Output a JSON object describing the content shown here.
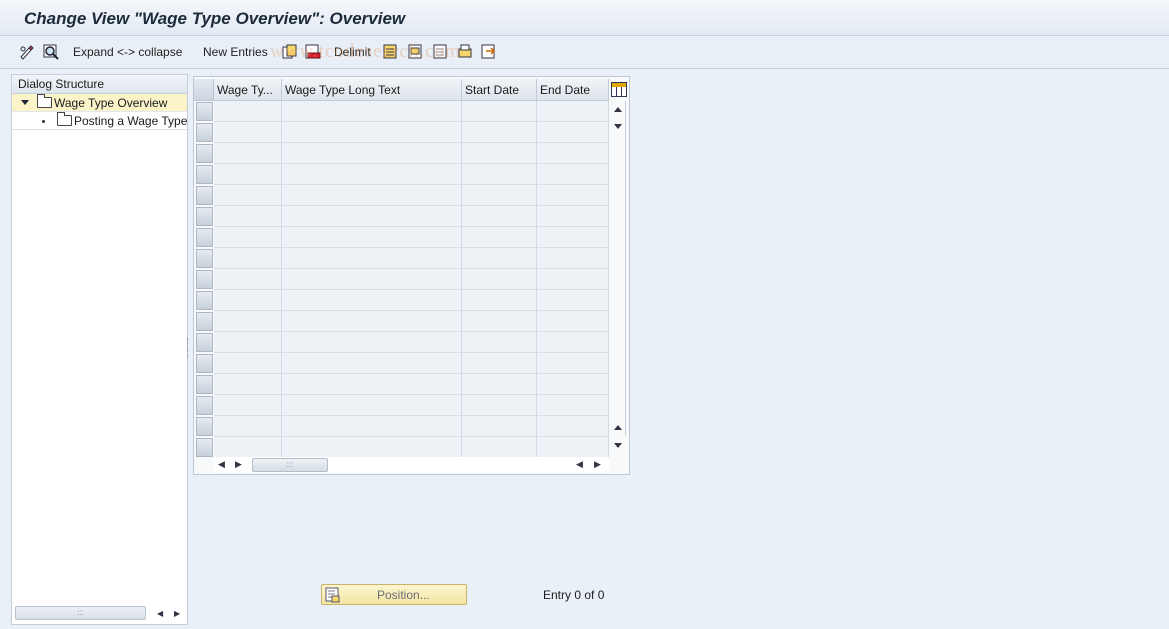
{
  "window": {
    "title": "Change View \"Wage Type Overview\": Overview"
  },
  "toolbar": {
    "expand_collapse_label": "Expand <-> collapse",
    "new_entries_label": "New Entries",
    "delimit_label": "Delimit"
  },
  "watermark": {
    "text": "www.tcodesearch.com"
  },
  "dialog_structure": {
    "header": "Dialog Structure",
    "items": [
      {
        "label": "Wage Type Overview"
      },
      {
        "label": "Posting a Wage Type"
      }
    ]
  },
  "table": {
    "columns": [
      "Wage Ty...",
      "Wage Type Long Text",
      "Start Date",
      "End Date"
    ],
    "row_count": 17
  },
  "footer": {
    "position_label": "Position...",
    "entry_status": "Entry 0 of 0"
  },
  "colors": {
    "selected_tree_row": "#fbf4c8",
    "position_button": "#f2e4a2",
    "background": "#eaf0f8"
  }
}
